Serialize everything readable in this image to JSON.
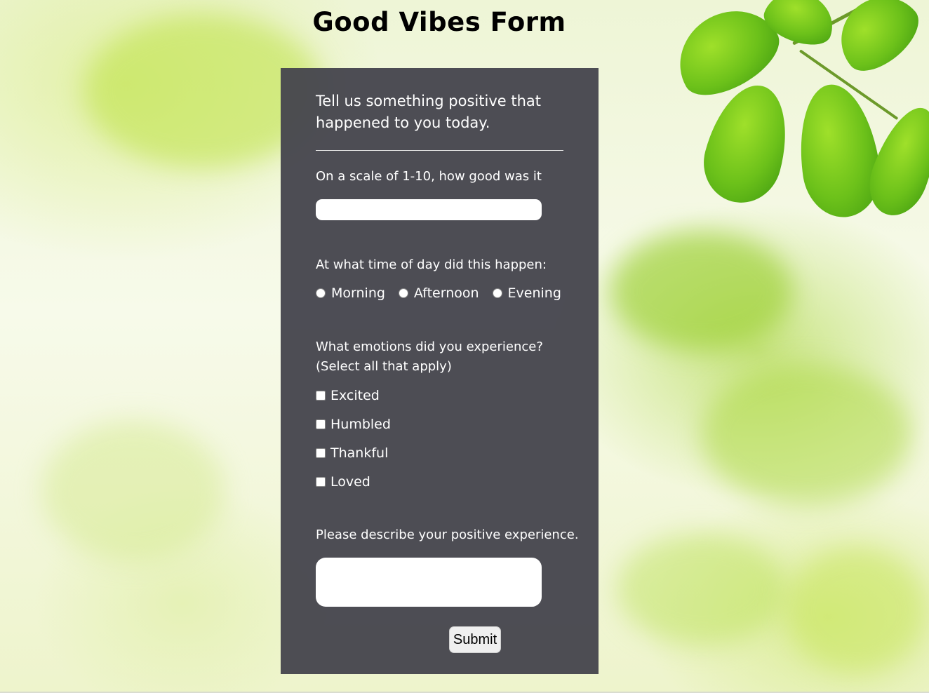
{
  "page": {
    "title": "Good Vibes Form"
  },
  "form": {
    "intro": "Tell us something positive that happened to you today.",
    "rating": {
      "label": "On a scale of 1-10, how good was it",
      "value": ""
    },
    "time_of_day": {
      "label": "At what time of day did this happen:",
      "options": [
        "Morning",
        "Afternoon",
        "Evening"
      ]
    },
    "emotions": {
      "label_line1": "What emotions did you experience?",
      "label_line2": "(Select all that apply)",
      "options": [
        "Excited",
        "Humbled",
        "Thankful",
        "Loved"
      ]
    },
    "description": {
      "label": "Please describe your positive experience.",
      "value": ""
    },
    "submit_label": "Submit"
  },
  "colors": {
    "panel_background": "#46464e",
    "panel_text": "#ffffff",
    "input_background": "#ffffff",
    "button_background": "#efefef",
    "leaf_green": "#6cc11a"
  },
  "icons": {
    "radio": "radio-circle-icon",
    "checkbox": "checkbox-icon"
  }
}
